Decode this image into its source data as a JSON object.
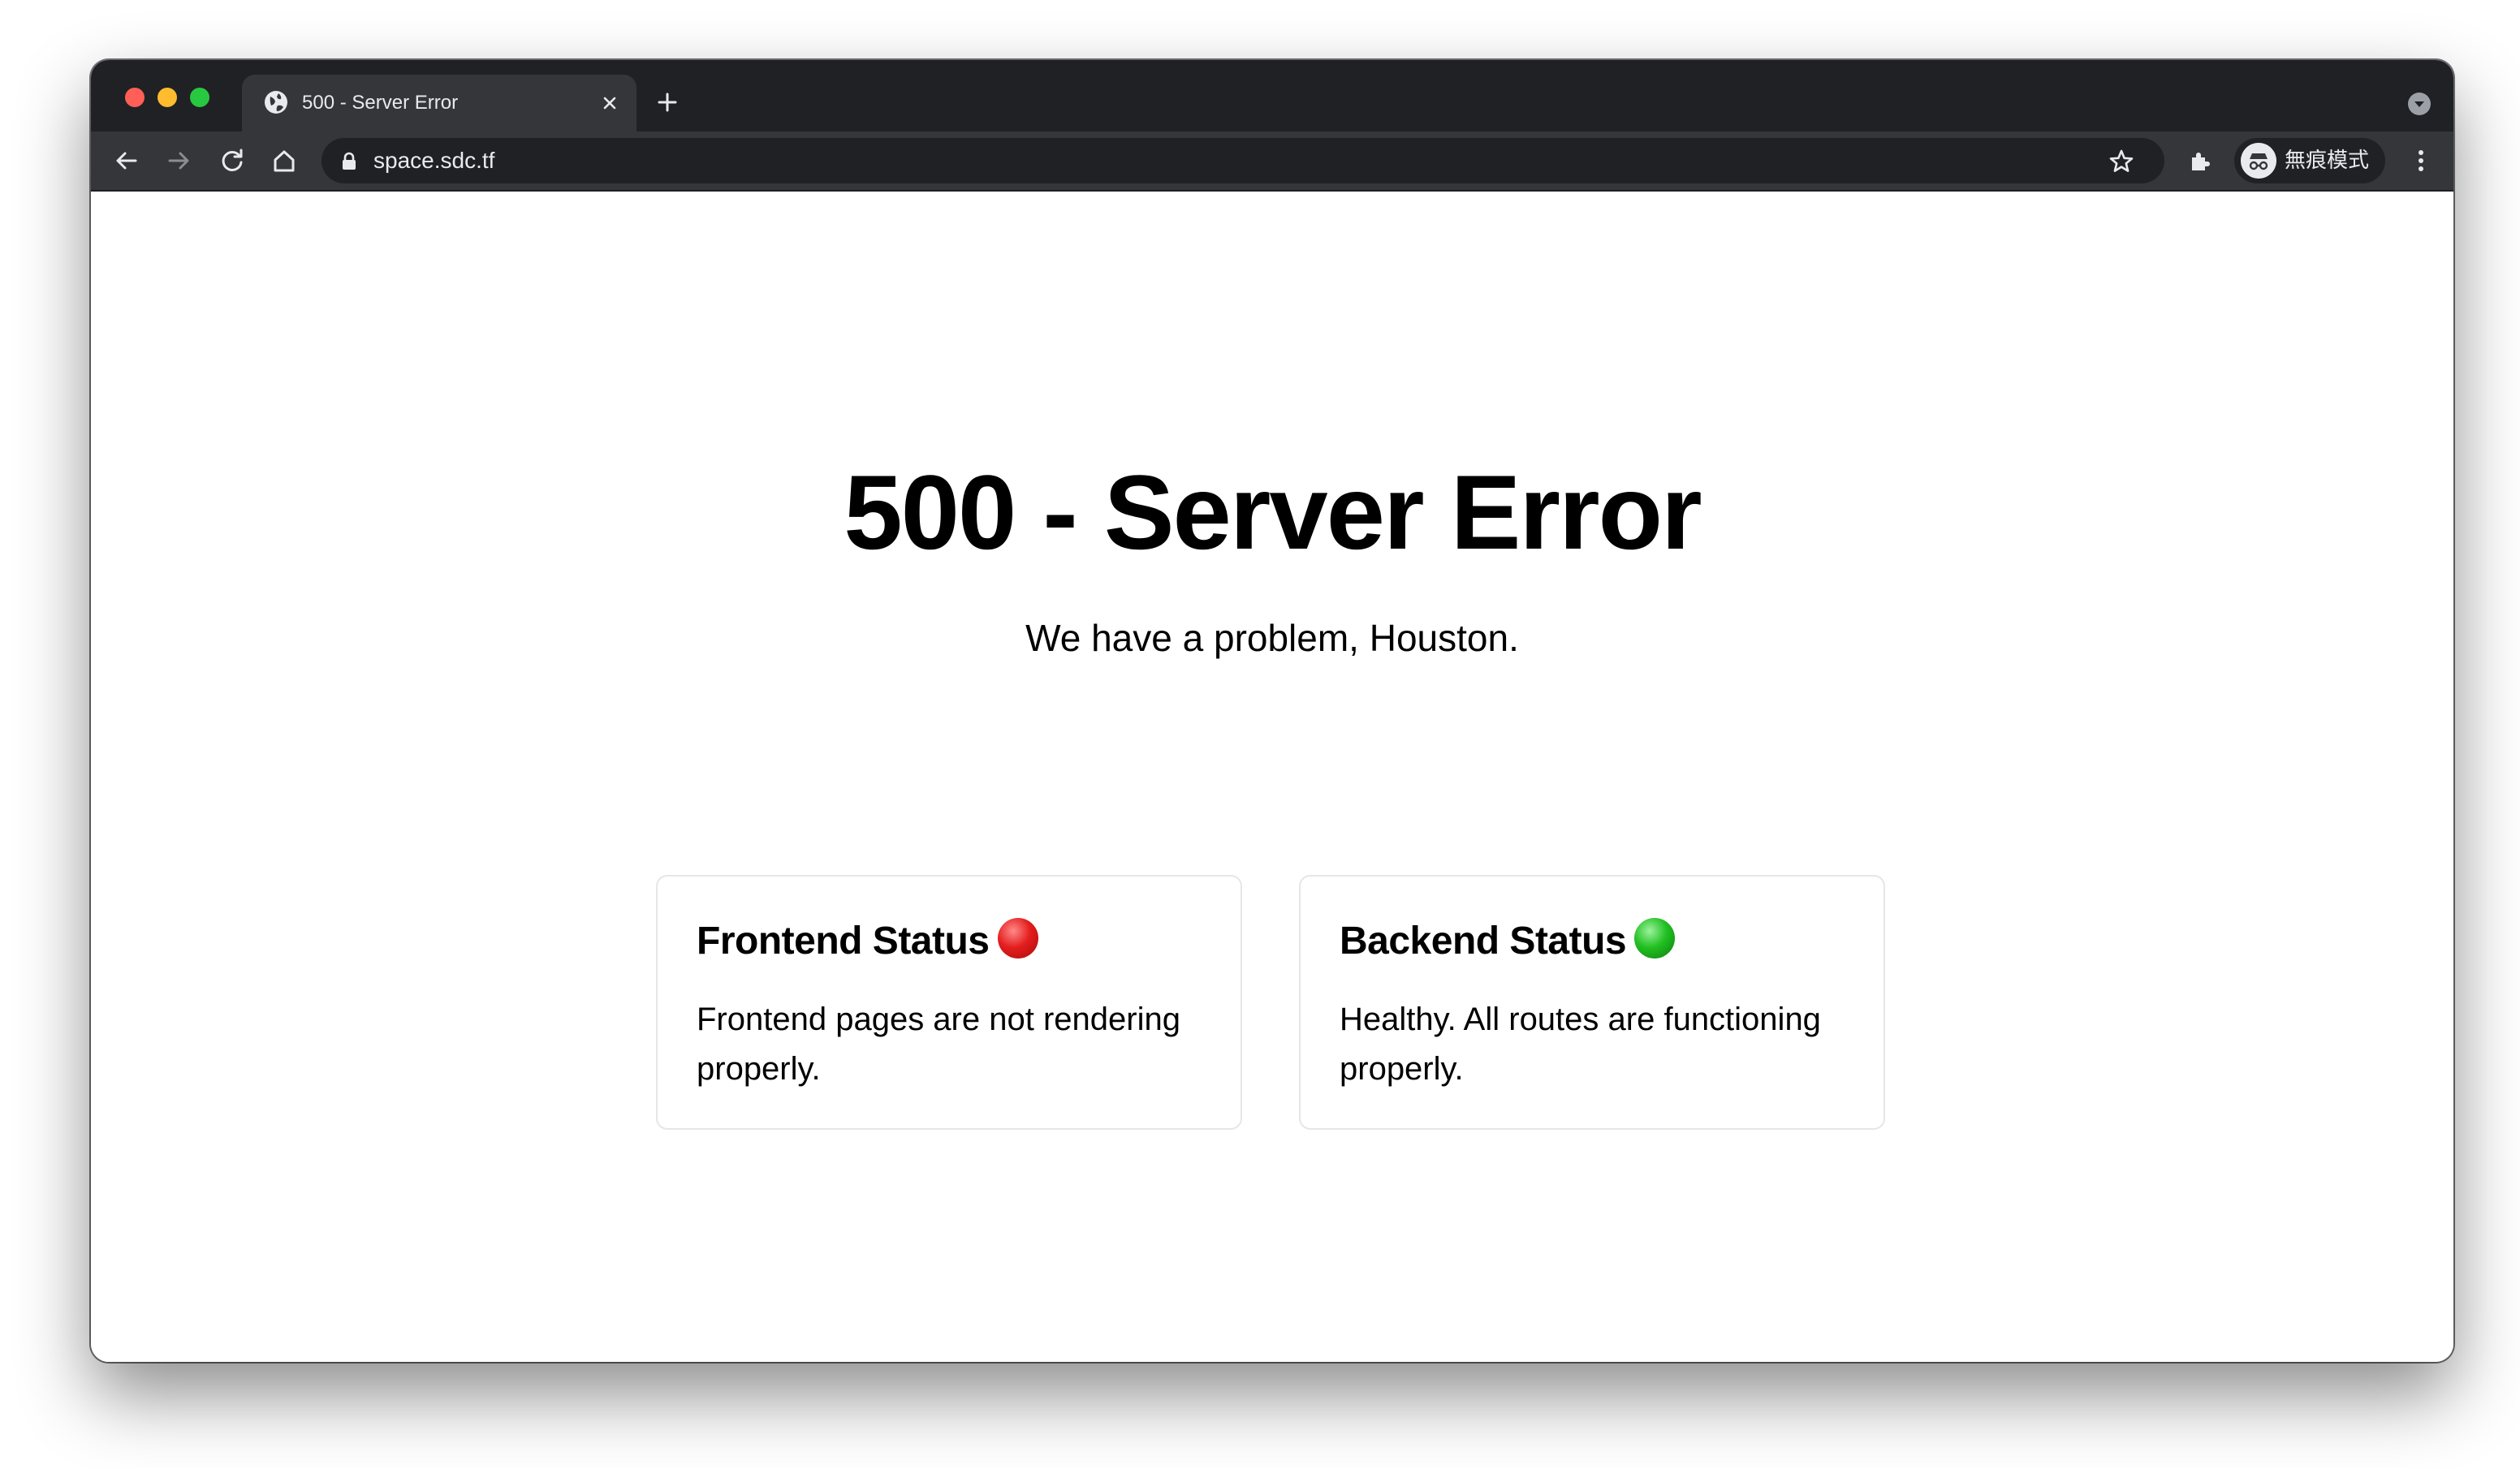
{
  "browser": {
    "tab": {
      "title": "500 - Server Error",
      "favicon": "globe-icon"
    },
    "address_bar": {
      "url": "space.sdc.tf",
      "secure_icon": "lock-icon"
    },
    "profile": {
      "label": "無痕模式",
      "icon": "incognito-icon"
    },
    "toolbar_icons": [
      "back-icon",
      "forward-icon",
      "reload-icon",
      "home-icon",
      "star-icon",
      "extensions-icon",
      "menu-icon"
    ],
    "colors": {
      "frame": "#202124",
      "toolbar": "#35363a",
      "close_light": "#ff5f57",
      "minimize_light": "#febc2e",
      "zoom_light": "#28c840"
    }
  },
  "page": {
    "title": "500 - Server Error",
    "subtitle": "We have a problem, Houston.",
    "cards": [
      {
        "title": "Frontend Status",
        "status": "red",
        "status_color": "#d7191c",
        "body": "Frontend pages are not rendering properly."
      },
      {
        "title": "Backend Status",
        "status": "green",
        "status_color": "#17a81a",
        "body": "Healthy. All routes are functioning properly."
      }
    ]
  }
}
